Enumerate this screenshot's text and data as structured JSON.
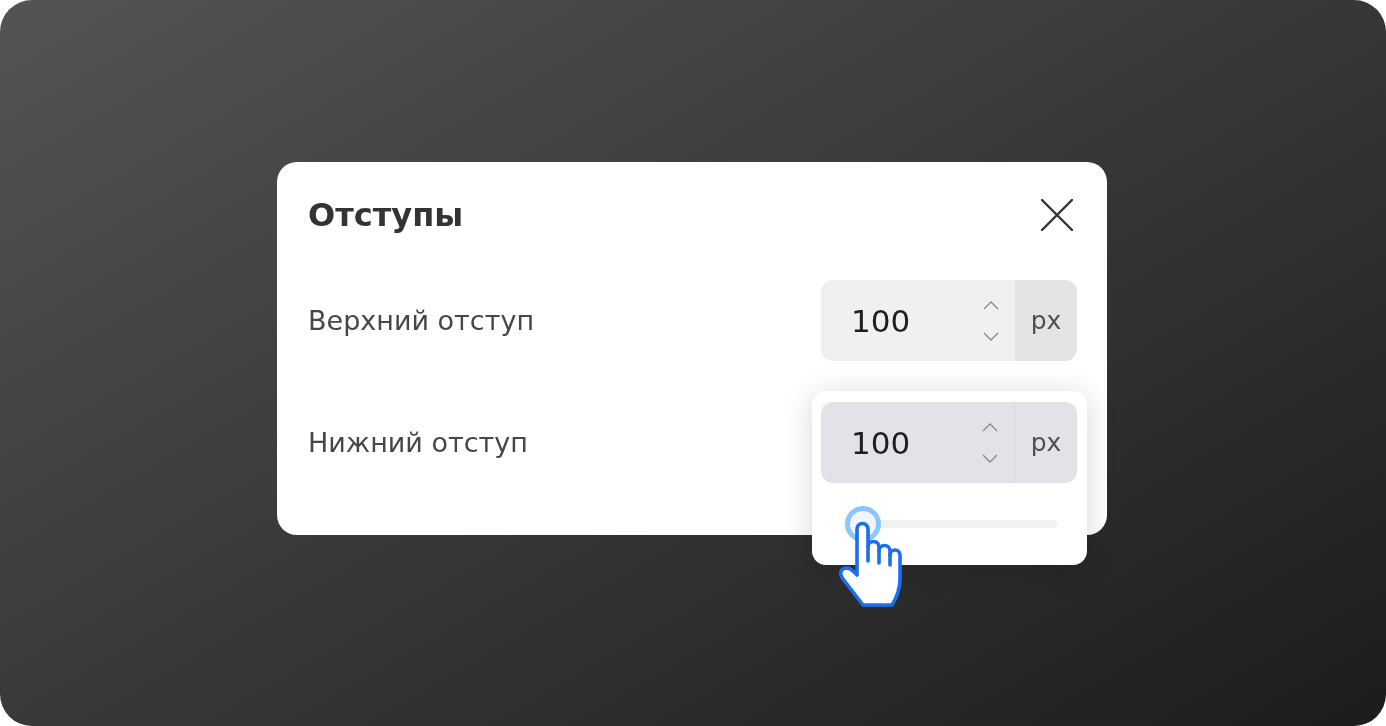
{
  "dialog": {
    "title": "Отступы",
    "fields": [
      {
        "label": "Верхний отступ",
        "value": "100",
        "unit": "px",
        "focused": false
      },
      {
        "label": "Нижний отступ",
        "value": "100",
        "unit": "px",
        "focused": true,
        "slider": {
          "level": 0.09
        }
      }
    ]
  }
}
